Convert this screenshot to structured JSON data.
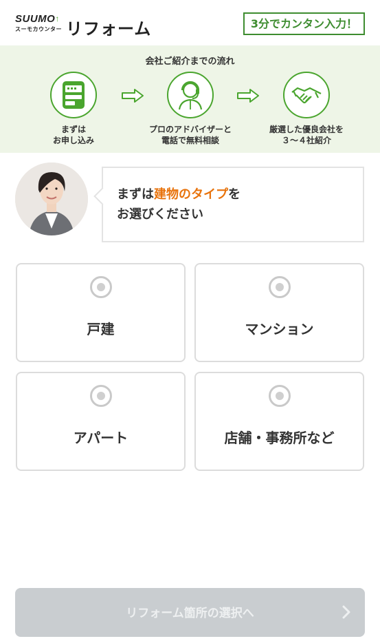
{
  "header": {
    "logo_suumo": "SUUMO",
    "logo_sub": "スーモカウンター",
    "logo_reform": "リフォーム",
    "badge": "3分でカンタン入力！"
  },
  "flow": {
    "title": "会社ご紹介までの流れ",
    "steps": [
      {
        "label": "まずは\nお申し込み",
        "icon": "form-icon"
      },
      {
        "label": "プロのアドバイザーと\n電話で無料相談",
        "icon": "advisor-icon"
      },
      {
        "label": "厳選した優良会社を\n３〜４社紹介",
        "icon": "handshake-icon"
      }
    ]
  },
  "guide": {
    "line1_prefix": "まずは",
    "line1_highlight": "建物のタイプ",
    "line1_suffix": "を",
    "line2": "お選びください"
  },
  "options": [
    {
      "label": "戸建"
    },
    {
      "label": "マンション"
    },
    {
      "label": "アパート"
    },
    {
      "label": "店舗・事務所など"
    }
  ],
  "next_button": {
    "label": "リフォーム箇所の選択へ"
  },
  "colors": {
    "brand_green": "#4aa52e",
    "highlight_orange": "#e8730c",
    "disabled_button": "#c9cdd0",
    "flow_bg": "#eef5e7"
  }
}
